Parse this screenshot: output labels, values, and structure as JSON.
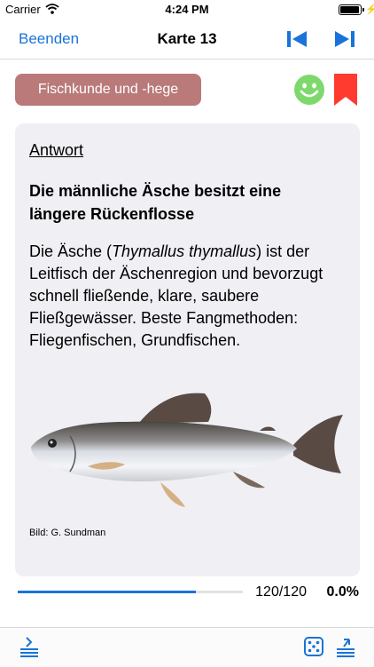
{
  "status_bar": {
    "carrier": "Carrier",
    "time": "4:24 PM"
  },
  "nav": {
    "back_label": "Beenden",
    "title": "Karte 13",
    "prev_icon": "skip-back-icon",
    "next_icon": "skip-forward-icon"
  },
  "category": {
    "label": "Fischkunde und -hege",
    "color": "#b97a79"
  },
  "status_icons": {
    "mood": "smiley-icon",
    "mood_color": "#7dd96b",
    "bookmark": "bookmark-icon",
    "bookmark_color": "#ff3b30"
  },
  "card": {
    "heading": "Antwort",
    "title": "Die männliche Äsche besitzt eine längere Rückenflosse",
    "body_before": "Die Äsche (",
    "body_italic": "Thymallus thymallus",
    "body_after": ") ist der Leitfisch der Äschenregion und bevorzugt schnell fließende, klare, saubere Fließgewässer. Beste Fangmethoden: Fliegenfischen, Grundfischen.",
    "image": "grayling-fish-illustration",
    "credit": "Bild: G. Sundman"
  },
  "progress": {
    "fraction": 0.79,
    "count": "120/120",
    "percent": "0.0%",
    "color": "#1a73d9"
  },
  "toolbar": {
    "left_icon": "collapse-list-icon",
    "dice_icon": "dice-icon",
    "right_icon": "expand-list-icon"
  }
}
